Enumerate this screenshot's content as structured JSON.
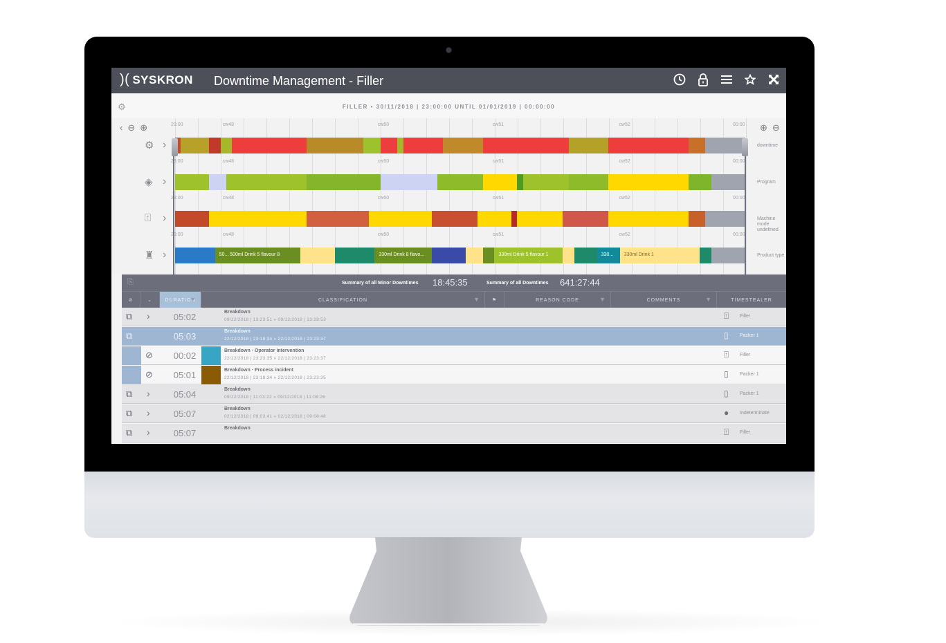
{
  "app": {
    "logo": "SYSKRON",
    "title": "Downtime Management  -  Filler",
    "header_icons": [
      "clock-icon",
      "lock-icon",
      "menu-icon",
      "star-icon",
      "fullscreen-icon"
    ]
  },
  "range": {
    "text": "FILLER • 30/11/2018 | 23:00:00 UNTIL 01/01/2019 | 00:00:00"
  },
  "timeline": {
    "controls_left": [
      "‹",
      "⊖",
      "⊕"
    ],
    "controls_right": [
      "⊕",
      "⊖"
    ],
    "axis": {
      "start": "23:00",
      "end": "00:00",
      "weeks": [
        "cw48",
        "cw50",
        "cw51",
        "cw52"
      ]
    },
    "tracks": [
      {
        "icon": "gear-icon",
        "label": "downtime",
        "segments": [
          {
            "from": 0,
            "to": 1,
            "color": "#c94b2d"
          },
          {
            "from": 1,
            "to": 6,
            "color": "#b8a128"
          },
          {
            "from": 6,
            "to": 8,
            "color": "#c0392b"
          },
          {
            "from": 8,
            "to": 10,
            "color": "#a7b72a"
          },
          {
            "from": 10,
            "to": 23,
            "color": "#ee3d3d"
          },
          {
            "from": 23,
            "to": 33,
            "color": "#b88a28"
          },
          {
            "from": 33,
            "to": 36,
            "color": "#9dc22b"
          },
          {
            "from": 36,
            "to": 39,
            "color": "#ee3d3d"
          },
          {
            "from": 39,
            "to": 40,
            "color": "#a7b72a"
          },
          {
            "from": 40,
            "to": 47,
            "color": "#ee3d3d"
          },
          {
            "from": 47,
            "to": 54,
            "color": "#c08a2a"
          },
          {
            "from": 54,
            "to": 69,
            "color": "#ee3d3d"
          },
          {
            "from": 69,
            "to": 76,
            "color": "#b3a128"
          },
          {
            "from": 76,
            "to": 90,
            "color": "#ee3d3d"
          },
          {
            "from": 90,
            "to": 93,
            "color": "#c8702a"
          },
          {
            "from": 93,
            "to": 100,
            "color": "#a0a4ae"
          }
        ]
      },
      {
        "icon": "program-icon",
        "label": "Program",
        "segments": [
          {
            "from": 0,
            "to": 6,
            "color": "#9dc22b"
          },
          {
            "from": 6,
            "to": 9,
            "color": "#cdd3f2"
          },
          {
            "from": 9,
            "to": 23,
            "color": "#9dc22b"
          },
          {
            "from": 23,
            "to": 36,
            "color": "#84b52a"
          },
          {
            "from": 36,
            "to": 46,
            "color": "#cdd3f2"
          },
          {
            "from": 46,
            "to": 54,
            "color": "#8dbb29"
          },
          {
            "from": 54,
            "to": 60,
            "color": "#ffd800"
          },
          {
            "from": 60,
            "to": 61,
            "color": "#4f9a22"
          },
          {
            "from": 61,
            "to": 69,
            "color": "#9dc22b"
          },
          {
            "from": 69,
            "to": 76,
            "color": "#8dbb29"
          },
          {
            "from": 76,
            "to": 90,
            "color": "#ffd800"
          },
          {
            "from": 90,
            "to": 94,
            "color": "#7fb52a"
          },
          {
            "from": 94,
            "to": 100,
            "color": "#a0a4ae"
          }
        ]
      },
      {
        "icon": "machine-mode-icon",
        "label": "Machine mode undefined",
        "segments": [
          {
            "from": 0,
            "to": 6,
            "color": "#c24a2a"
          },
          {
            "from": 6,
            "to": 23,
            "color": "#ffd800"
          },
          {
            "from": 23,
            "to": 34,
            "color": "#d06040"
          },
          {
            "from": 34,
            "to": 45,
            "color": "#ffd800"
          },
          {
            "from": 45,
            "to": 53,
            "color": "#c85030"
          },
          {
            "from": 53,
            "to": 59,
            "color": "#ffd800"
          },
          {
            "from": 59,
            "to": 60,
            "color": "#b82a2a"
          },
          {
            "from": 60,
            "to": 68,
            "color": "#ffd800"
          },
          {
            "from": 68,
            "to": 76,
            "color": "#d0584a"
          },
          {
            "from": 76,
            "to": 90,
            "color": "#ffd800"
          },
          {
            "from": 90,
            "to": 93,
            "color": "#c8602a"
          },
          {
            "from": 93,
            "to": 100,
            "color": "#a0a4ae"
          }
        ]
      },
      {
        "icon": "bottle-icon",
        "label": "Product type",
        "segments": [
          {
            "from": 0,
            "to": 7,
            "color": "#2a7ac8"
          },
          {
            "from": 7,
            "to": 22,
            "color": "#6b8e23",
            "label": "50... 500ml Drink 5 flavour 8"
          },
          {
            "from": 22,
            "to": 28,
            "color": "#ffe38a"
          },
          {
            "from": 28,
            "to": 35,
            "color": "#1e8a6a"
          },
          {
            "from": 35,
            "to": 45,
            "color": "#6b8e23",
            "label": "330ml Drink 8 flavo..."
          },
          {
            "from": 45,
            "to": 51,
            "color": "#3a4aa8"
          },
          {
            "from": 51,
            "to": 54,
            "color": "#ffe38a"
          },
          {
            "from": 54,
            "to": 56,
            "color": "#6b8e23"
          },
          {
            "from": 56,
            "to": 68,
            "color": "#9dc22b",
            "label": "330ml Drink 5 flavour 1"
          },
          {
            "from": 68,
            "to": 70,
            "color": "#ffe38a"
          },
          {
            "from": 70,
            "to": 74,
            "color": "#1e8a6a"
          },
          {
            "from": 74,
            "to": 78,
            "color": "#138a9a",
            "label": "330..."
          },
          {
            "from": 78,
            "to": 92,
            "color": "#ffe38a",
            "label": "330ml Drink 1",
            "dark": true
          },
          {
            "from": 92,
            "to": 94,
            "color": "#1e8a6a"
          },
          {
            "from": 94,
            "to": 100,
            "color": "#a0a4ae"
          }
        ]
      }
    ]
  },
  "summary": {
    "minor_label": "Summary of all Minor Downtimes",
    "minor_value": "18:45:35",
    "all_label": "Summary of all Downtimes",
    "all_value": "641:27:44"
  },
  "table": {
    "columns": [
      "DURATION",
      "CLASSIFICATION",
      "REASON CODE",
      "COMMENTS",
      "TIMESTEALER"
    ],
    "rows": [
      {
        "type": "parent",
        "duration": "05:02",
        "title": "Breakdown",
        "time": "09/12/2018 | 13:23:51 » 09/12/2018 | 13:28:53",
        "te_icon": "filler-icon",
        "timestealer": "Filler"
      },
      {
        "type": "selected",
        "duration": "05:03",
        "title": "Breakdown",
        "time": "22/12/2018 | 23:18:34 » 22/12/2018 | 23:23:37",
        "te_icon": "packer-icon",
        "timestealer": "Packer 1"
      },
      {
        "type": "child",
        "duration": "00:02",
        "title": "Breakdown · Operator intervention",
        "time": "22/12/2018 | 23:23:35 » 22/12/2018 | 23:23:37",
        "swatch": "#36a6c4",
        "te_icon": "filler-icon",
        "timestealer": "Filler"
      },
      {
        "type": "child",
        "duration": "05:01",
        "title": "Breakdown · Process incident",
        "time": "22/12/2018 | 23:18:34 » 22/12/2018 | 23:23:35",
        "swatch": "#8a5a05",
        "te_icon": "packer-icon",
        "timestealer": "Packer 1"
      },
      {
        "type": "parent",
        "duration": "05:04",
        "title": "Breakdown",
        "time": "09/12/2018 | 11:03:22 » 09/12/2018 | 11:08:26",
        "te_icon": "packer-icon",
        "timestealer": "Packer 1"
      },
      {
        "type": "parent",
        "duration": "05:07",
        "title": "Breakdown",
        "time": "02/12/2018 | 09:03:41 » 02/12/2018 | 09:08:48",
        "te_icon": "dot-icon",
        "timestealer": "Indeterminate"
      },
      {
        "type": "parent",
        "duration": "05:07",
        "title": "Breakdown",
        "time": "",
        "te_icon": "filler-icon",
        "timestealer": "Filler"
      }
    ]
  }
}
